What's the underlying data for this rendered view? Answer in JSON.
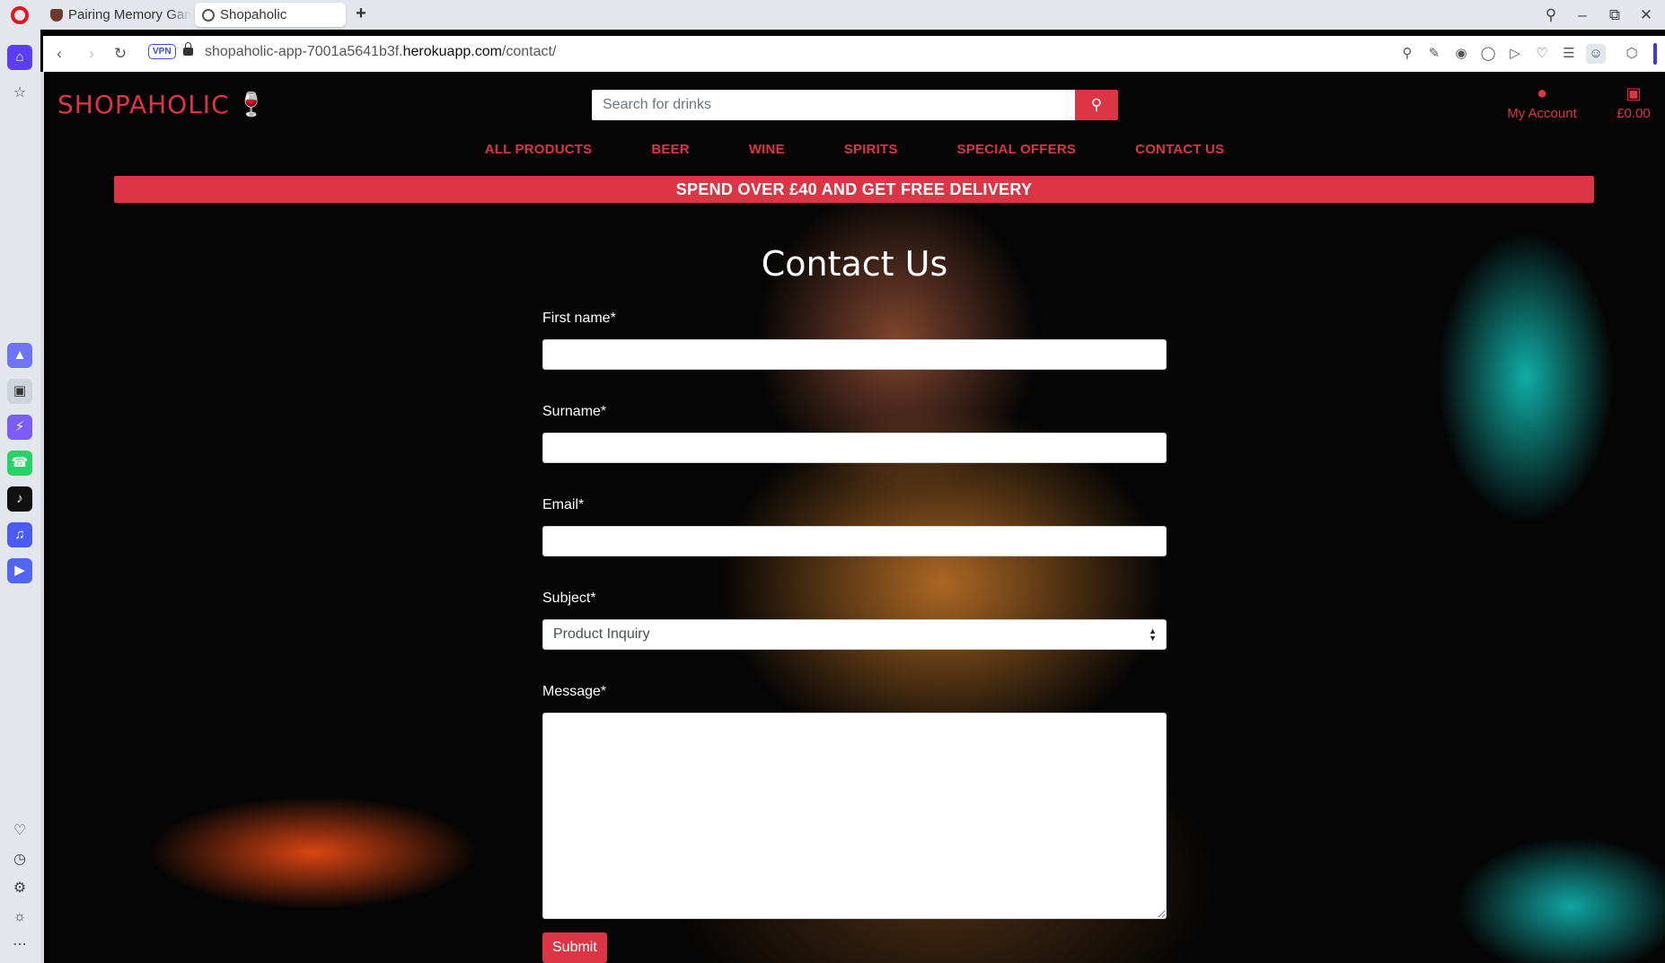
{
  "browser": {
    "tabs": [
      {
        "title": "Pairing Memory Gam",
        "active": false
      },
      {
        "title": "Shopaholic",
        "active": true
      }
    ],
    "new_tab": "+",
    "address": {
      "vpn": "VPN",
      "url_prefix": "shopaholic-app-7001a5641b3f.",
      "url_domain": "herokuapp.com",
      "url_path": "/contact/"
    }
  },
  "header": {
    "logo_text": "SHOPAHOLIC",
    "logo_icon": "wine-glasses-icon",
    "search_placeholder": "Search for drinks",
    "search_icon": "search-icon",
    "account_label": "My Account",
    "cart_total": "£0.00"
  },
  "nav": {
    "items": [
      "ALL PRODUCTS",
      "BEER",
      "WINE",
      "SPIRITS",
      "SPECIAL OFFERS",
      "CONTACT US"
    ]
  },
  "banner": "SPEND OVER £40 AND GET FREE DELIVERY",
  "contact": {
    "title": "Contact Us",
    "first_name_label": "First name*",
    "surname_label": "Surname*",
    "email_label": "Email*",
    "subject_label": "Subject*",
    "subject_value": "Product Inquiry",
    "message_label": "Message*",
    "submit_label": "Submit"
  },
  "colors": {
    "accent": "#dc3545",
    "background": "#000000",
    "text": "#ffffff"
  }
}
